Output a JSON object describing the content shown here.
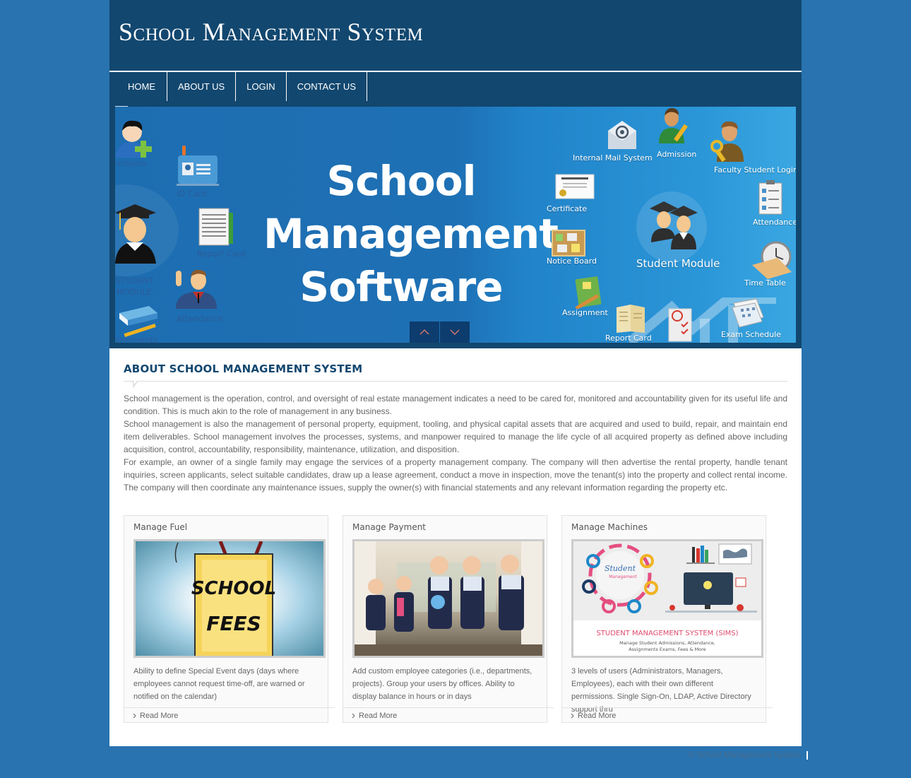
{
  "header": {
    "title": "School Management System"
  },
  "nav": {
    "items": [
      {
        "label": "HOME"
      },
      {
        "label": "ABOUT US"
      },
      {
        "label": "LOGIN"
      },
      {
        "label": "CONTACT US"
      }
    ]
  },
  "banner": {
    "headline_lines": [
      "School",
      "Management",
      "Software"
    ],
    "left_labels": [
      "mission",
      "ID Card",
      "Report Card",
      "STUDENT",
      "MODULE",
      "Attendance",
      "signments"
    ],
    "right_labels": {
      "internal_mail": "Internal Mail System",
      "admission": "Admission",
      "faculty_login": "Faculty Student Login",
      "certificate": "Certificate",
      "attendance": "Attendance",
      "notice_board": "Notice Board",
      "student_module": "Student Module",
      "time_table": "Time Table",
      "assignment": "Assignment",
      "report_card": "Report Card",
      "exam_schedule": "Exam Schedule"
    },
    "controls": {
      "prev_icon": "chevron-up-icon",
      "next_icon": "chevron-down-icon"
    }
  },
  "about": {
    "title": "ABOUT SCHOOL MANAGEMENT SYSTEM",
    "paragraphs": [
      "School management is the operation, control, and oversight of real estate management indicates a need to be cared for, monitored and accountability given for its useful life and condition. This is much akin to the role of management in any business.",
      "School management is also the management of personal property, equipment, tooling, and physical capital assets that are acquired and used to build, repair, and maintain end item deliverables. School management involves the processes, systems, and manpower required to manage the life cycle of all acquired property as defined above including acquisition, control, accountability, responsibility, maintenance, utilization, and disposition.",
      "For example, an owner of a single family may engage the services of a property management company. The company will then advertise the rental property, handle tenant inquiries, screen applicants, select suitable candidates, draw up a lease agreement, conduct a move in inspection, move the tenant(s) into the property and collect rental income. The company will then coordinate any maintenance issues, supply the owner(s) with financial statements and any relevant information regarding the property etc."
    ]
  },
  "cards": [
    {
      "title": "Manage Fuel",
      "image_text": [
        "SCHOOL",
        "FEES"
      ],
      "description": "Ability to define Special Event days (days where employees cannot request time-off, are warned or notified on the calendar)",
      "link": "Read More"
    },
    {
      "title": "Manage Payment",
      "image_text": [],
      "description": "Add custom employee categories (i.e., departments, projects). Group your users by offices. Ability to display balance in hours or in days",
      "link": "Read More"
    },
    {
      "title": "Manage Machines",
      "image_text": [
        "Student",
        "Management",
        "STUDENT MANAGEMENT SYSTEM (SIMS)",
        "Manage Student Admissions, Attendance,",
        "Assignments Exams, Fees & More"
      ],
      "description": "3 levels of users (Administrators, Managers, Employees), each with their own different permissions. Single Sign-On, LDAP, Active Directory support thru",
      "link": "Read More"
    }
  ],
  "footer": {
    "copyright": "© School Management System"
  },
  "colors": {
    "page_bg": "#2873b0",
    "header_bg": "#12476f",
    "title_color": "#12476f",
    "text_color": "#666666"
  }
}
